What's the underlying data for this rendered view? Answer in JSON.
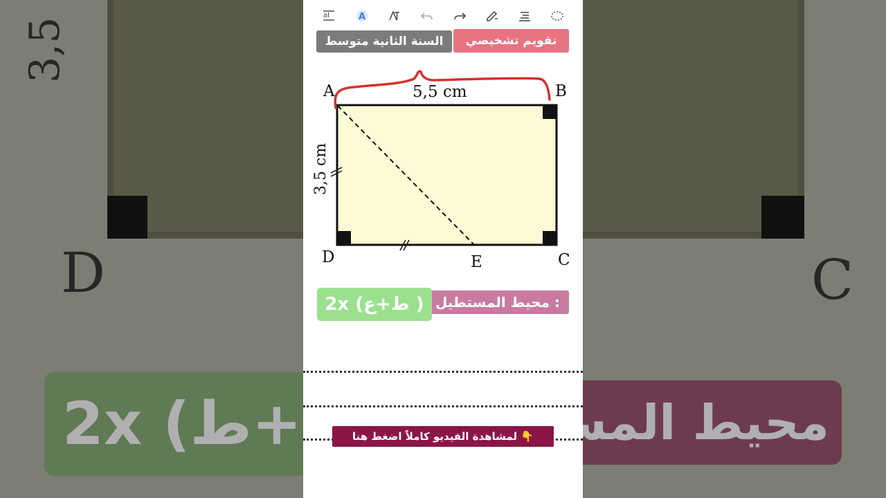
{
  "toolbar": {
    "icons": [
      "text-size-icon",
      "font-icon",
      "text-tool-icon",
      "undo-icon",
      "redo-icon",
      "pen-icon",
      "align-icon",
      "lasso-icon"
    ]
  },
  "header": {
    "badge_red": "تقويم تشخيصي",
    "badge_gray": "السنة الثانية متوسط"
  },
  "figure": {
    "vertices": {
      "A": "A",
      "B": "B",
      "C": "C",
      "D": "D",
      "E": "E"
    },
    "top_length": "5,5 cm",
    "side_length": "3,5 cm"
  },
  "formula": {
    "label": "محيط المستطيل :",
    "expression": "2x (ط+ع )"
  },
  "cta": {
    "text": "لمشاهدة الفيديو كاملاً اضغط هنا 👇"
  },
  "background": {
    "left_side_label": "3,5",
    "left_vertex": "D",
    "right_vertex": "C",
    "left_pill_text": "2x (ع+ط",
    "right_pill_text": "محيط المس"
  },
  "colors": {
    "badge_red": "#e87383",
    "badge_gray": "#7b7b7b",
    "formula_label": "#c97aa0",
    "formula_expr": "#9be08f",
    "rect_fill": "#fdfbd6",
    "annotation": "#d6312b",
    "cta_bg": "#8c1547"
  }
}
